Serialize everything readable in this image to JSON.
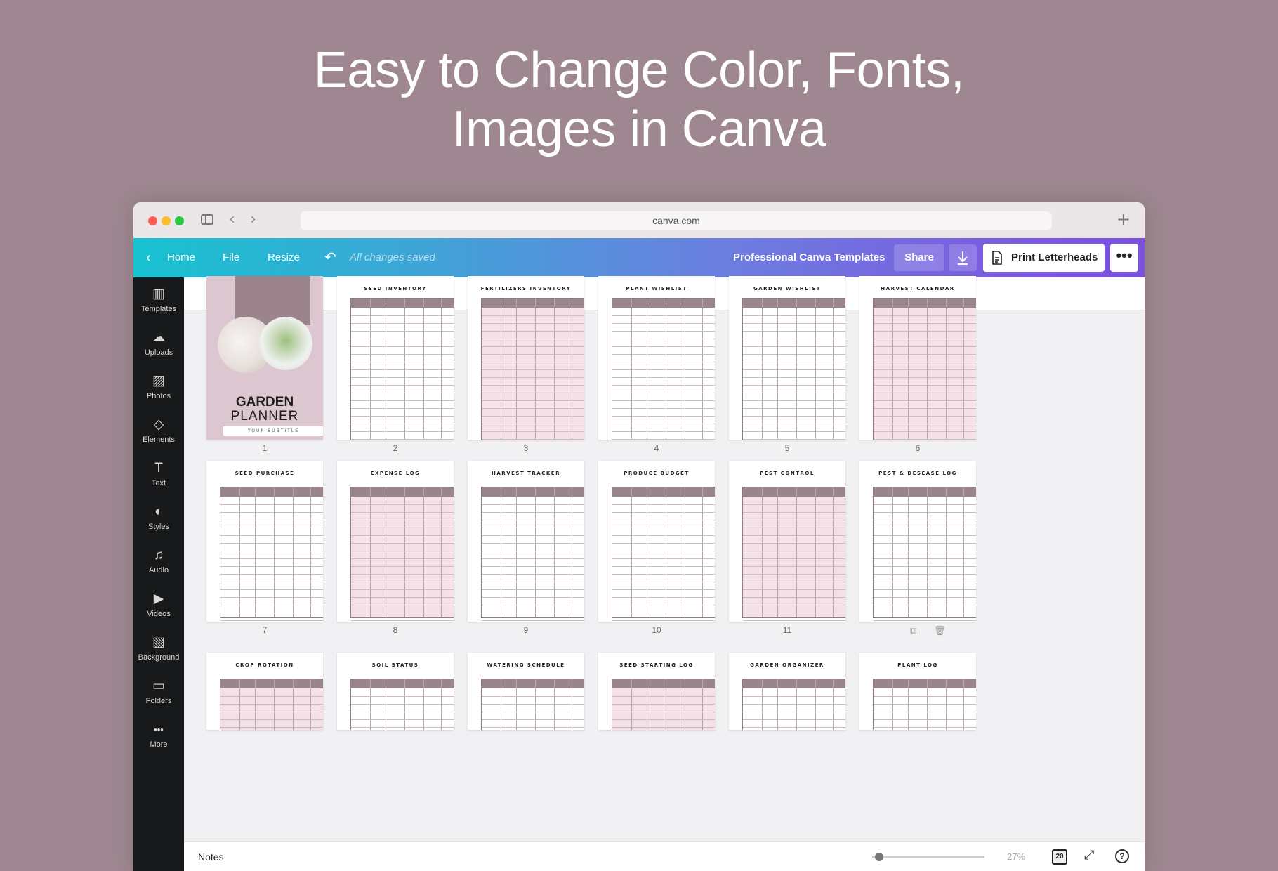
{
  "headline": {
    "line1": "Easy to Change Color, Fonts,",
    "line2": "Images in Canva"
  },
  "browser": {
    "url": "canva.com",
    "colors": {
      "close": "#fe5f57",
      "minimize": "#febc2e",
      "maximize": "#28c840"
    }
  },
  "toolbar": {
    "home": "Home",
    "file": "File",
    "resize": "Resize",
    "saved_status": "All changes saved",
    "design_title": "Professional Canva Templates",
    "share": "Share",
    "print": "Print Letterheads",
    "more": "•••"
  },
  "sidebar": {
    "items": [
      {
        "label": "Templates",
        "icon": "templates-icon"
      },
      {
        "label": "Uploads",
        "icon": "upload-icon"
      },
      {
        "label": "Photos",
        "icon": "photo-icon"
      },
      {
        "label": "Elements",
        "icon": "elements-icon"
      },
      {
        "label": "Text",
        "icon": "text-icon"
      },
      {
        "label": "Styles",
        "icon": "palette-icon"
      },
      {
        "label": "Audio",
        "icon": "music-icon"
      },
      {
        "label": "Videos",
        "icon": "video-icon"
      },
      {
        "label": "Background",
        "icon": "background-icon"
      },
      {
        "label": "Folders",
        "icon": "folder-icon"
      },
      {
        "label": "More",
        "icon": "more-icon"
      }
    ]
  },
  "cover": {
    "title_bold": "GARDEN",
    "title_light": "PLANNER",
    "subtitle": "YOUR SUBTITLE"
  },
  "pages": [
    {
      "number": "1",
      "title": ""
    },
    {
      "number": "2",
      "title": "SEED INVENTORY"
    },
    {
      "number": "3",
      "title": "FERTILIZERS INVENTORY"
    },
    {
      "number": "4",
      "title": "PLANT WISHLIST"
    },
    {
      "number": "5",
      "title": "GARDEN WISHLIST"
    },
    {
      "number": "6",
      "title": "HARVEST CALENDAR"
    },
    {
      "number": "7",
      "title": "SEED PURCHASE"
    },
    {
      "number": "8",
      "title": "EXPENSE LOG"
    },
    {
      "number": "9",
      "title": "HARVEST TRACKER"
    },
    {
      "number": "10",
      "title": "PRODUCE BUDGET"
    },
    {
      "number": "11",
      "title": "PEST CONTROL"
    },
    {
      "number": "",
      "title": "PEST & DESEASE LOG"
    },
    {
      "number": "",
      "title": "CROP ROTATION"
    },
    {
      "number": "",
      "title": "SOIL STATUS"
    },
    {
      "number": "",
      "title": "WATERING SCHEDULE"
    },
    {
      "number": "",
      "title": "SEED STARTING LOG"
    },
    {
      "number": "",
      "title": "GARDEN ORGANIZER"
    },
    {
      "number": "",
      "title": "PLANT LOG"
    }
  ],
  "bottombar": {
    "notes": "Notes",
    "zoom": "27%",
    "page_count": "20",
    "zoom_fraction": 0.05
  }
}
